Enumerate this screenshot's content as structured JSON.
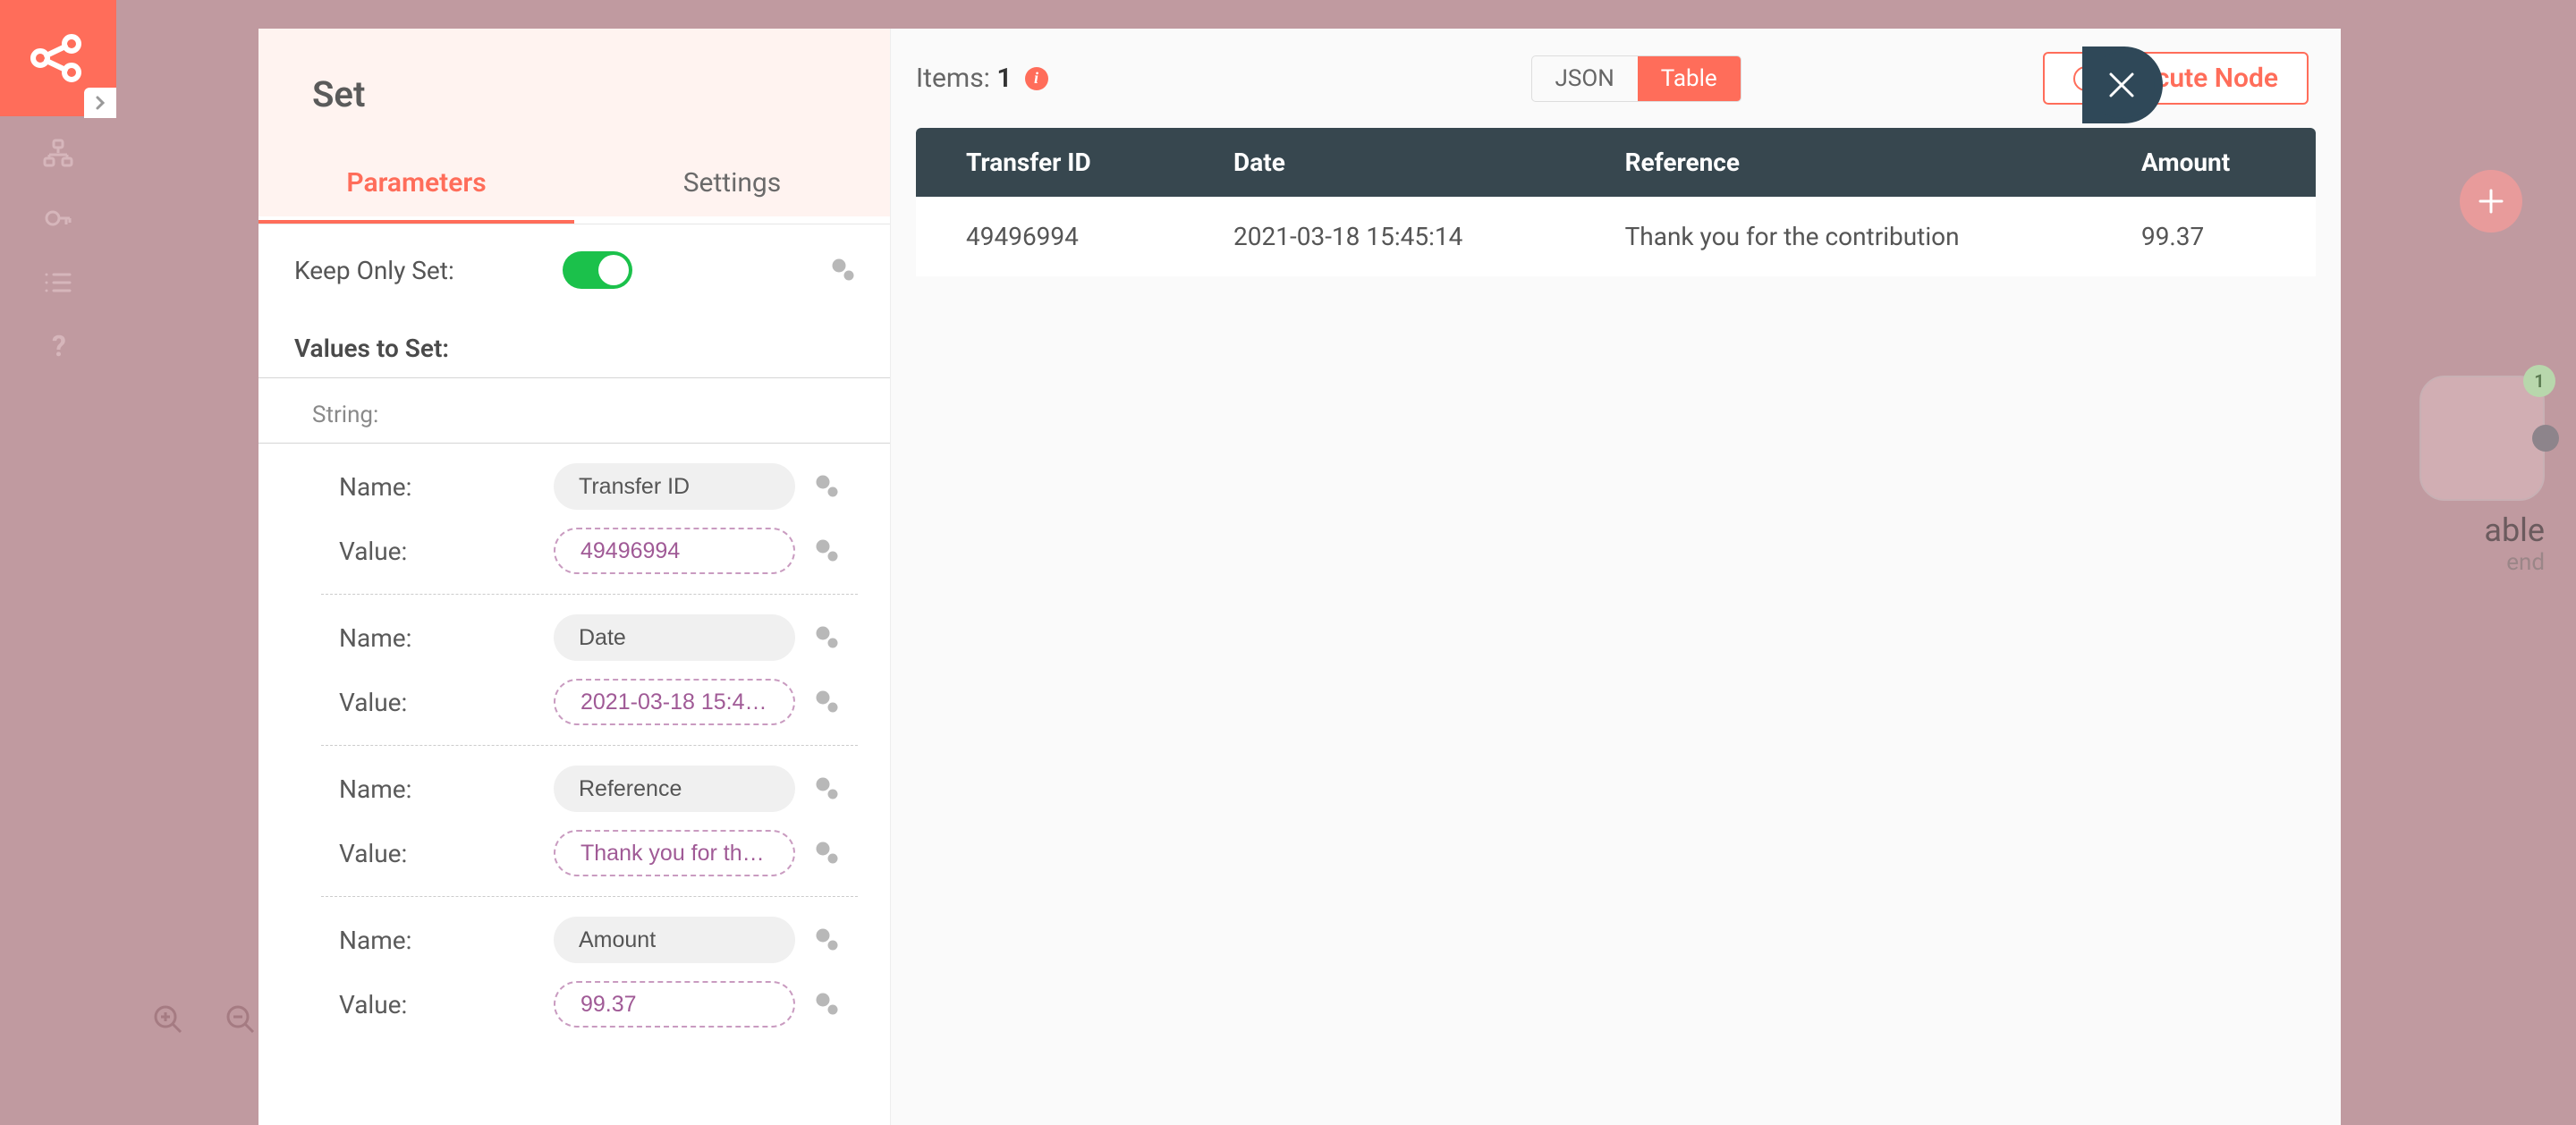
{
  "modal": {
    "title": "Set",
    "tabs": {
      "parameters": "Parameters",
      "settings": "Settings",
      "active": 0
    },
    "keep_only_set": {
      "label": "Keep Only Set:",
      "value": true
    },
    "values_header": "Values to Set:",
    "subsection": "String:",
    "name_label": "Name:",
    "value_label": "Value:",
    "fields": [
      {
        "name": "Transfer ID",
        "value": "49496994"
      },
      {
        "name": "Date",
        "value": "2021-03-18 15:4 …"
      },
      {
        "name": "Reference",
        "value": "Thank you for th …"
      },
      {
        "name": "Amount",
        "value": "99.37"
      }
    ]
  },
  "results": {
    "items_label": "Items:",
    "count": "1",
    "view": {
      "json": "JSON",
      "table": "Table",
      "active": "table"
    },
    "execute": "Execute Node",
    "columns": [
      "Transfer ID",
      "Date",
      "Reference",
      "Amount"
    ],
    "rows": [
      [
        "49496994",
        "2021-03-18 15:45:14",
        "Thank you for the contribution",
        "99.37"
      ]
    ]
  },
  "bg": {
    "node_label": "able",
    "node_sublabel": "end",
    "node_badge": "1"
  }
}
